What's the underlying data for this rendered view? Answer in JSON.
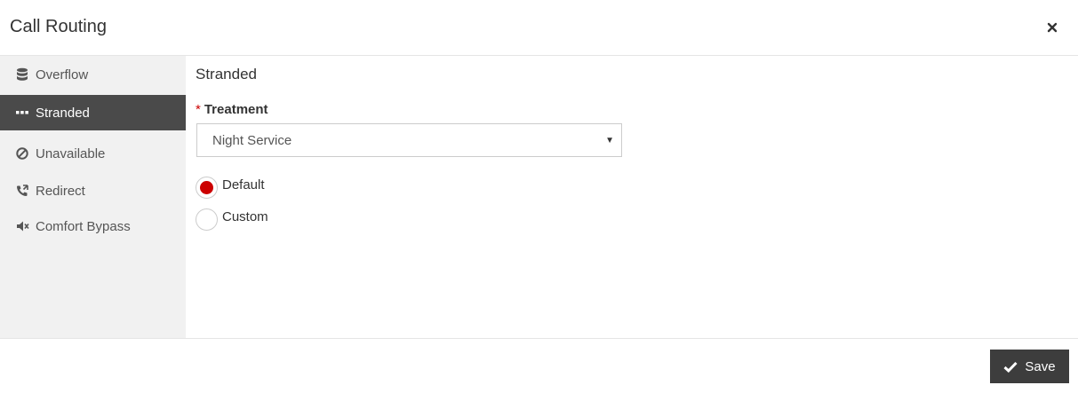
{
  "dialog": {
    "title": "Call Routing"
  },
  "sidebar": {
    "items": [
      {
        "label": "Overflow",
        "icon": "database-icon"
      },
      {
        "label": "Stranded",
        "icon": "ellipsis-icon",
        "active": true
      },
      {
        "label": "Unavailable",
        "icon": "ban-icon"
      },
      {
        "label": "Redirect",
        "icon": "phone-forward-icon"
      },
      {
        "label": "Comfort Bypass",
        "icon": "volume-mute-icon"
      }
    ]
  },
  "main": {
    "section_title": "Stranded",
    "treatment": {
      "required_mark": "*",
      "label": "Treatment",
      "value": "Night Service"
    },
    "options": [
      {
        "label": "Default",
        "checked": true
      },
      {
        "label": "Custom",
        "checked": false
      }
    ]
  },
  "footer": {
    "save_label": "Save"
  },
  "colors": {
    "accent": "#cc0000",
    "active_bg": "#4a4a4a",
    "sidebar_bg": "#f1f1f1",
    "button_bg": "#3d3d3d"
  }
}
